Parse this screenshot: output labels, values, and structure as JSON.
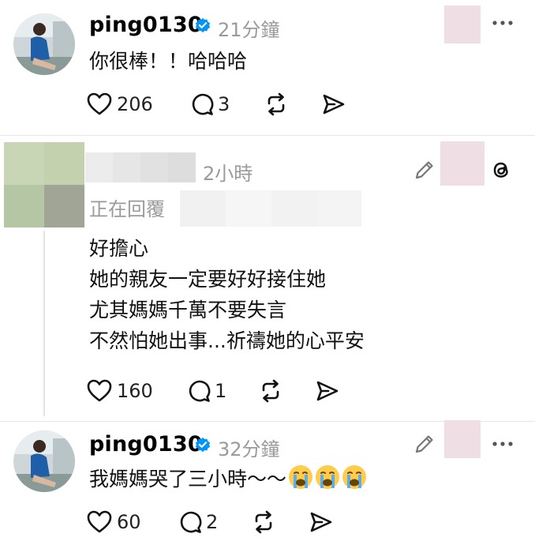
{
  "post1": {
    "username": "ping0130",
    "time": "21分鐘",
    "body": "你很棒！！哈哈哈",
    "likes": "206",
    "replies": "3"
  },
  "post2": {
    "time": "2小時",
    "replying_label": "正在回覆",
    "body": "好擔心\n她的親友一定要好好接住她\n尤其媽媽千萬不要失言\n不然怕她出事...祈禱她的心平安",
    "likes": "160",
    "replies": "1"
  },
  "post3": {
    "username": "ping0130",
    "time": "32分鐘",
    "body": "我媽媽哭了三小時～～",
    "emojis": [
      "loudly-crying-face",
      "loudly-crying-face",
      "loudly-crying-face"
    ],
    "likes": "60",
    "replies": "2"
  },
  "icons": {
    "verified": "verified-badge-icon",
    "heart": "heart-icon",
    "comment": "comment-icon",
    "repost": "repost-icon",
    "share": "share-icon",
    "more": "more-icon",
    "edit": "pencil-icon",
    "threads": "threads-logo-icon"
  },
  "colors": {
    "verified": "#0095f6",
    "muted": "#9a9a9a",
    "redacted_pink": "#efdfe4"
  }
}
